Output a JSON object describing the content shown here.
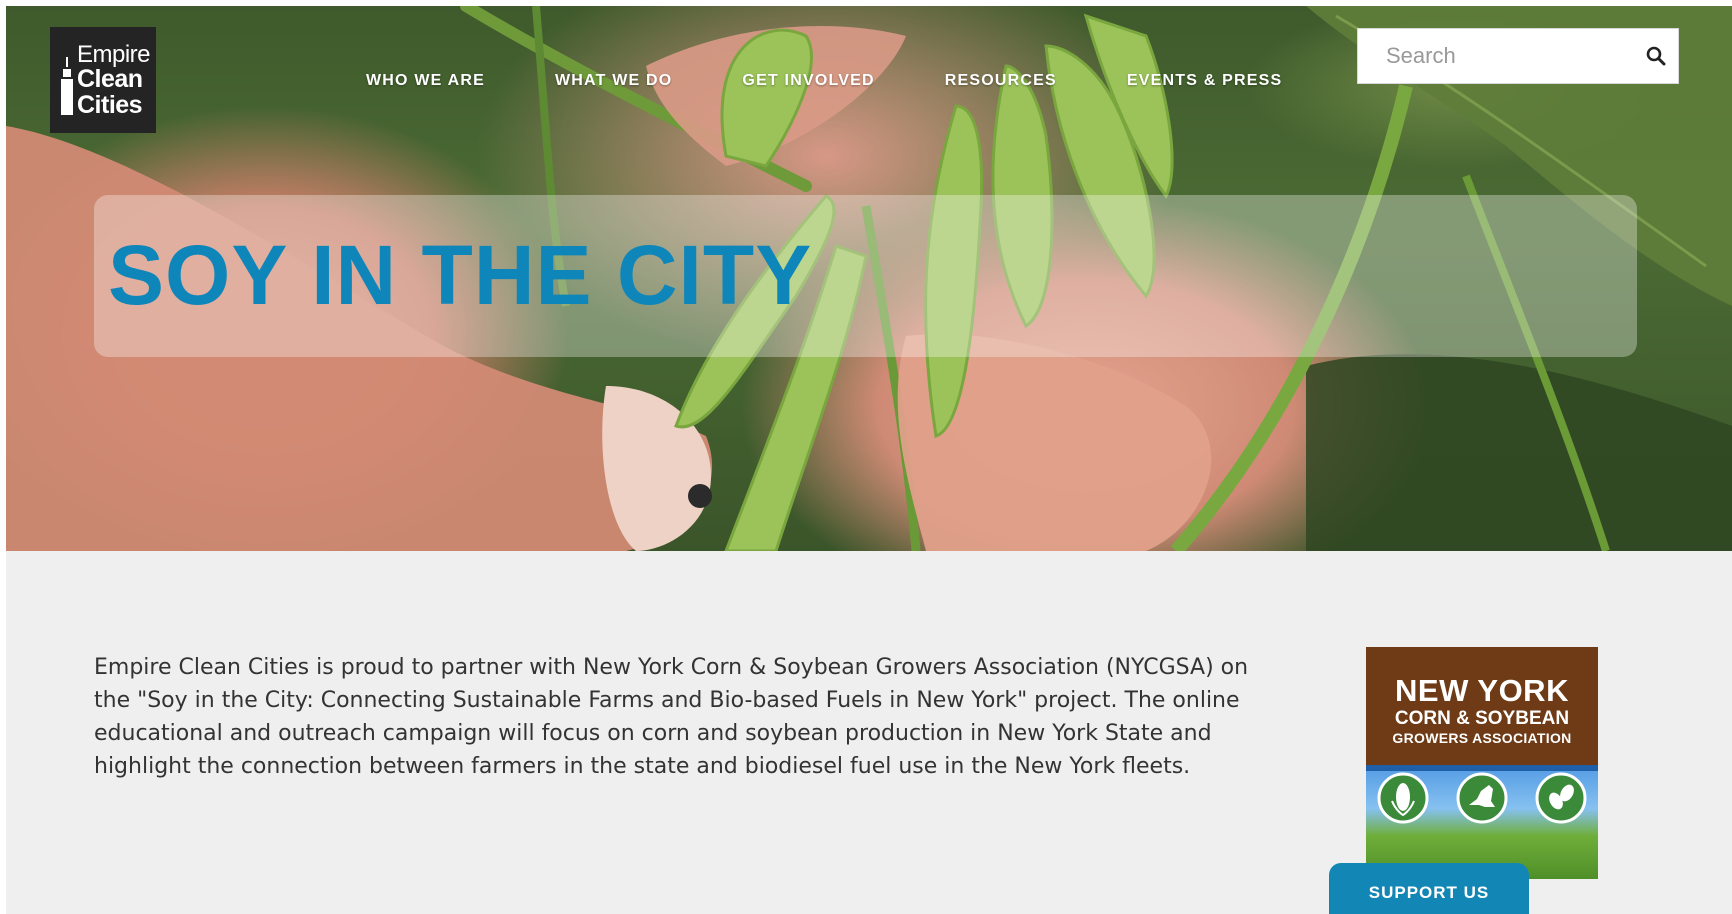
{
  "brand": {
    "line1": "Empire",
    "line2": "Clean",
    "line3": "Cities",
    "icon": "skyscraper-icon"
  },
  "nav": {
    "items": [
      {
        "label": "WHO WE ARE"
      },
      {
        "label": "WHAT WE DO"
      },
      {
        "label": "GET INVOLVED"
      },
      {
        "label": "RESOURCES"
      },
      {
        "label": "EVENTS & PRESS"
      }
    ]
  },
  "search": {
    "placeholder": "Search",
    "value": "",
    "icon": "search-icon"
  },
  "hero": {
    "title": "SOY IN THE CITY",
    "title_color": "#0f86b9"
  },
  "content": {
    "intro": "Empire Clean Cities is proud to partner with New York Corn & Soybean Growers Association (NYCGSA) on the \"Soy in the City: Connecting Sustainable Farms and Bio-based Fuels in New York\" project. The online educational and outreach campaign will focus on corn and soybean production in New York State and highlight the connection between farmers in the state and biodiesel fuel use in the New York fleets."
  },
  "partner": {
    "line1": "NEW YORK",
    "line2": "CORN & SOYBEAN",
    "line3": "GROWERS ASSOCIATION",
    "icons": [
      "corn-icon",
      "new-york-state-icon",
      "soybean-icon"
    ],
    "brand_color": "#6e3b16"
  },
  "support": {
    "label": "SUPPORT US",
    "color": "#1287b6"
  }
}
